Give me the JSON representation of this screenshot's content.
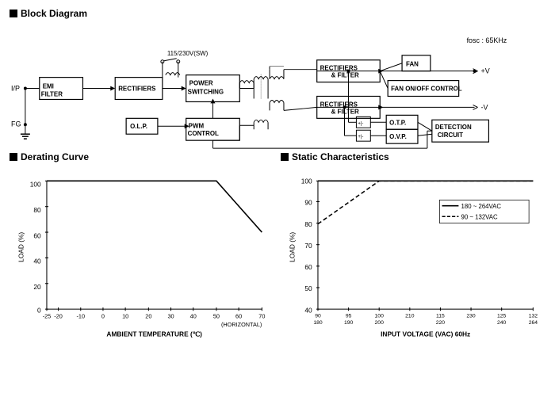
{
  "blockDiagram": {
    "title": "Block Diagram"
  },
  "deratingCurve": {
    "title": "Derating Curve",
    "xAxisLabel": "AMBIENT TEMPERATURE (℃)",
    "yAxisLabel": "LOAD (%)",
    "xTicks": [
      "-25",
      "-20",
      "-10",
      "0",
      "10",
      "20",
      "30",
      "40",
      "50",
      "60",
      "70"
    ],
    "yTicks": [
      "0",
      "20",
      "40",
      "60",
      "80",
      "100"
    ],
    "horizontalLabel": "(HORIZONTAL)"
  },
  "staticCharacteristics": {
    "title": "Static Characteristics",
    "xAxisLabel": "INPUT VOLTAGE (VAC) 60Hz",
    "yAxisLabel": "LOAD (%)",
    "xTicks": [
      "90",
      "95",
      "100",
      "200",
      "210",
      "220",
      "115",
      "230",
      "125",
      "240",
      "132",
      "264"
    ],
    "xTicksDisplay": [
      "90\n180",
      "95\n190",
      "200",
      "210",
      "220",
      "115\n230",
      "125\n240",
      "132\n264"
    ],
    "yTicks": [
      "40",
      "50",
      "60",
      "70",
      "80",
      "90",
      "100"
    ],
    "legend1": "180 ~ 264VAC",
    "legend2": "90 ~ 132VAC",
    "foscLabel": "fosc : 65KHz"
  }
}
